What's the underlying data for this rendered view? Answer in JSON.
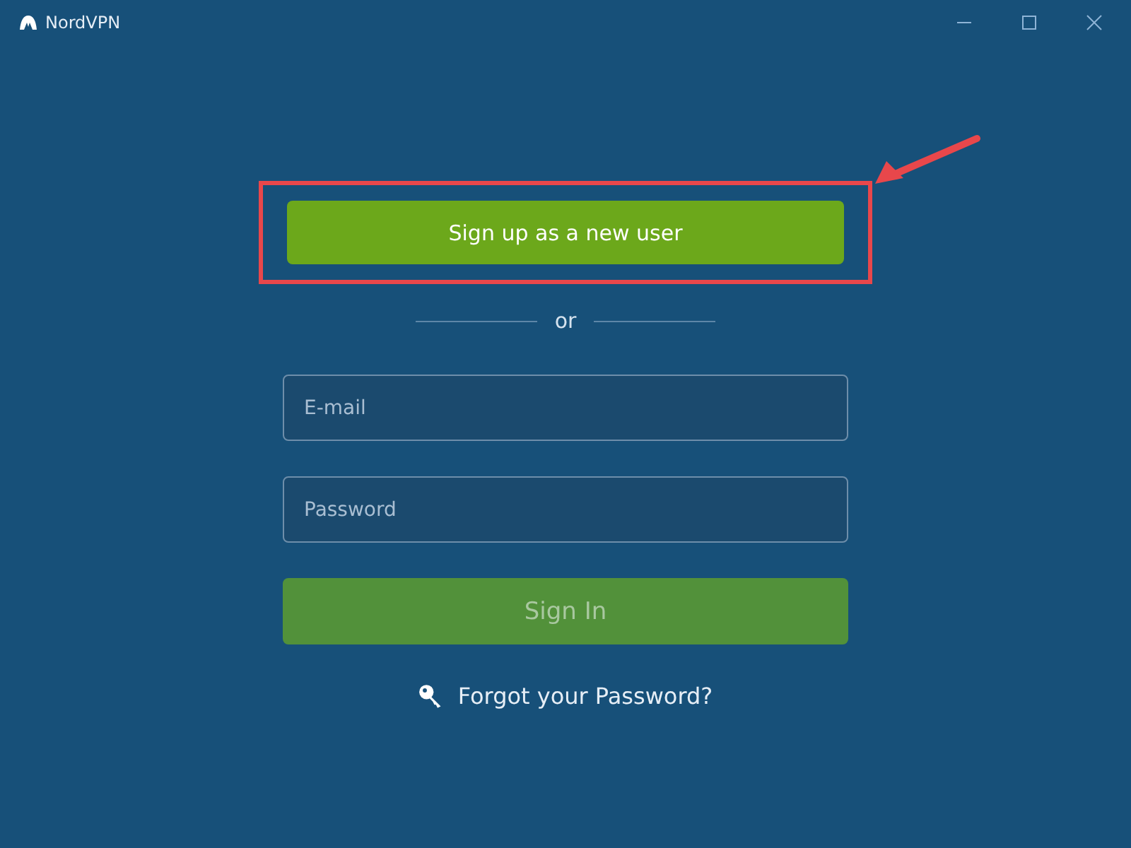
{
  "window": {
    "title": "NordVPN"
  },
  "signup_button": {
    "label": "Sign up as a new user"
  },
  "divider": {
    "label": "or"
  },
  "fields": [
    {
      "placeholder": "E-mail"
    },
    {
      "placeholder": "Password"
    }
  ],
  "signin_button": {
    "label": "Sign In",
    "disabled": true
  },
  "forgot_link": {
    "label": "Forgot your Password?"
  }
}
